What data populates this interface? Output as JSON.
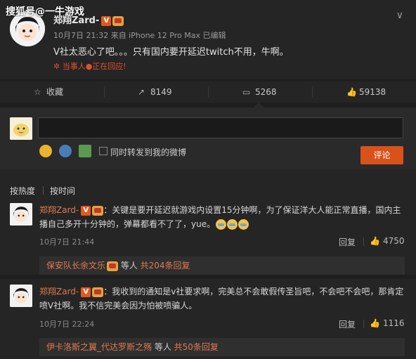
{
  "watermark": "搜狐号@一牛游戏",
  "post": {
    "author": "郑翔Zard-",
    "vip_badge": "V",
    "meta": "10月7日 21:32 来自 iPhone 12 Pro Max  已编辑",
    "body": "V社太恶心了吧。。。只有国内要开延迟twitch不用，牛啊。",
    "live_status": "✲ 当事人●正在回应!",
    "chevron": "∨"
  },
  "actions": {
    "favorite": "收藏",
    "repost_count": "8149",
    "comment_count": "5268",
    "like_count": "59138"
  },
  "compose": {
    "checkbox_label": "同时转发到我的微博",
    "submit_label": "评论"
  },
  "sort": {
    "by_hot": "按热度",
    "by_time": "按时间"
  },
  "comments": [
    {
      "author": "郑翔Zard-",
      "vip_badge": "V",
      "text": "关键是要开延迟就游戏内设置15分钟啊，为了保证洋大人能正常直播，国内主播自己多开十分钟的，弹幕都看不了了，yue。",
      "time": "10月7日 21:44",
      "reply_label": "回复",
      "likes": "4750",
      "sub_name": "保安队长余文乐",
      "sub_mid": " 等人 ",
      "sub_count": "共204条回复"
    },
    {
      "author": "郑翔Zard-",
      "vip_badge": "V",
      "text": "我收到的通知是v社要求啊，完美总不会敢假传圣旨吧，不会吧不会吧，那肯定喷V社啊。我不信完美会因为怕被喷骗人。",
      "time": "10月7日 22:24",
      "reply_label": "回复",
      "likes": "1116",
      "sub_name": "伊卡洛斯之翼_代达罗斯之殇",
      "sub_mid": " 等人 ",
      "sub_count": "共50条回复"
    }
  ],
  "colors": {
    "background": "#1e1e1e",
    "panel": "#252525",
    "accent_orange": "#d9521c",
    "link_orange": "#e07a4e",
    "live_red": "#e0502f"
  }
}
